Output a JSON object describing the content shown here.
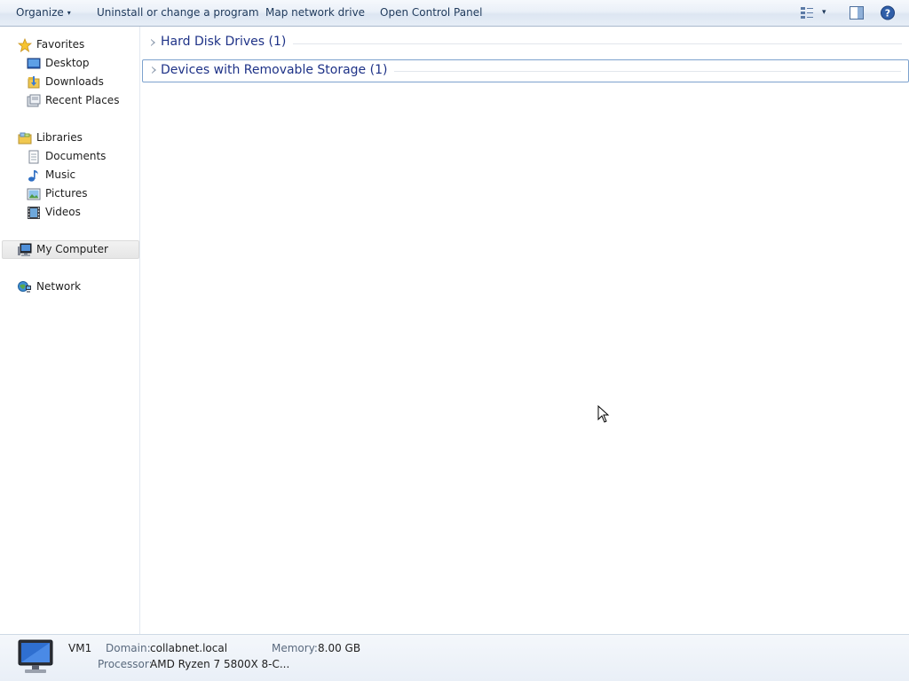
{
  "toolbar": {
    "organize_label": "Organize",
    "organize_arrow": "▾",
    "uninstall_label": "Uninstall or change a program",
    "map_drive_label": "Map network drive",
    "control_panel_label": "Open Control Panel",
    "view_arrow": "▾",
    "icons": [
      "view-options-icon",
      "preview-pane-icon",
      "help-icon"
    ]
  },
  "nav": {
    "favorites": {
      "label": "Favorites",
      "items": [
        {
          "label": "Desktop",
          "icon": "desktop-icon"
        },
        {
          "label": "Downloads",
          "icon": "downloads-folder-icon"
        },
        {
          "label": "Recent Places",
          "icon": "recent-places-icon"
        }
      ]
    },
    "libraries": {
      "label": "Libraries",
      "items": [
        {
          "label": "Documents",
          "icon": "documents-icon"
        },
        {
          "label": "Music",
          "icon": "music-icon"
        },
        {
          "label": "Pictures",
          "icon": "pictures-icon"
        },
        {
          "label": "Videos",
          "icon": "videos-icon"
        }
      ]
    },
    "computer": {
      "label": "My Computer",
      "selected": true
    },
    "network": {
      "label": "Network"
    }
  },
  "content": {
    "groups": [
      {
        "title": "Hard Disk Drives (1)",
        "expanded": false
      },
      {
        "title": "Devices with Removable Storage (1)",
        "expanded": false,
        "focused": true
      }
    ]
  },
  "details": {
    "name": "VM1",
    "domain_label": "Domain:",
    "domain_value": "collabnet.local",
    "memory_label": "Memory:",
    "memory_value": "8.00 GB",
    "processor_label": "Processor:",
    "processor_value": "AMD Ryzen 7 5800X 8-C..."
  },
  "colors": {
    "accent": "#1e3287",
    "toolbar_text": "#1e395b",
    "group_border": "#7da2ce"
  }
}
